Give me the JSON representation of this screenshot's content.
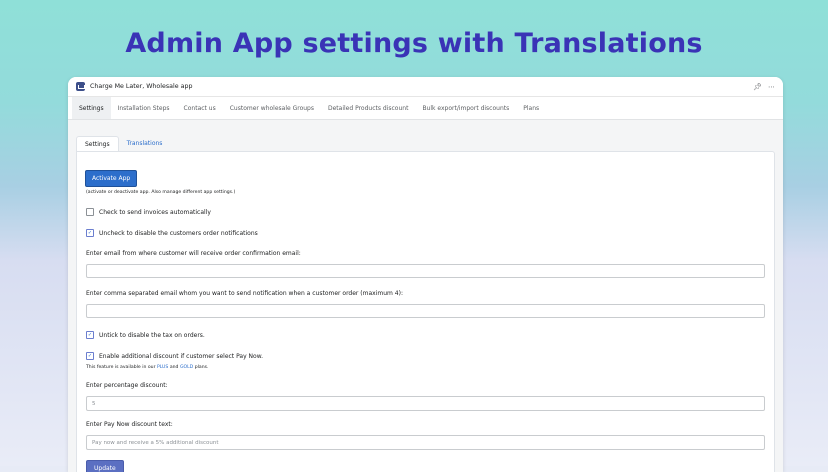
{
  "headline": "Admin App settings with Translations",
  "window": {
    "app_title": "Charge Me Later, Wholesale app",
    "pin_icon": "pin-icon",
    "more_icon": "more-horizontal-icon"
  },
  "nav": {
    "items": [
      {
        "label": "Settings"
      },
      {
        "label": "Installation Steps"
      },
      {
        "label": "Contact us"
      },
      {
        "label": "Customer wholesale Groups"
      },
      {
        "label": "Detailed Products discount"
      },
      {
        "label": "Bulk export/import discounts"
      },
      {
        "label": "Plans"
      }
    ],
    "active_index": 0
  },
  "subtabs": {
    "settings": "Settings",
    "translations": "Translations"
  },
  "form": {
    "activate_button": "Activate App",
    "activate_hint": "(activate or deactivate app. Also manage different app settings.)",
    "send_invoices": {
      "label": "Check to send invoices automatically",
      "checked": false
    },
    "order_notifications": {
      "label": "Uncheck to disable the customers order notifications",
      "checked": true
    },
    "from_email_label": "Enter email from where customer will receive order confirmation email:",
    "from_email_value": "",
    "notify_emails_label": "Enter comma separated email whom you want to send notification when a customer order (maximum 4):",
    "notify_emails_value": "",
    "tax": {
      "label": "Untick to disable the tax on orders.",
      "checked": true
    },
    "pay_now_discount": {
      "label": "Enable additional discount if customer select Pay Now.",
      "checked": true
    },
    "plan_note_prefix": "This feature is available in our",
    "plan_plus": "PLUS",
    "plan_and": "and",
    "plan_gold": "GOLD",
    "plan_suffix": "plans.",
    "percentage_label": "Enter percentage discount:",
    "percentage_placeholder": "5",
    "paynow_text_label": "Enter Pay Now discount text:",
    "paynow_text_placeholder": "Pay now and receive a 5% additional discount",
    "update_button": "Update"
  },
  "colors": {
    "headline": "#3a33b6",
    "primary": "#2c6ecb",
    "update": "#5b6fc2"
  }
}
